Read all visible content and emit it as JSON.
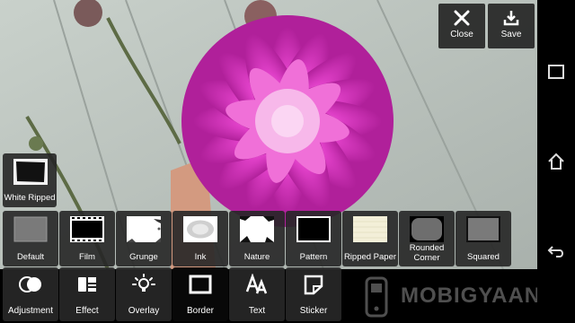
{
  "top_actions": {
    "close_label": "Close",
    "save_label": "Save"
  },
  "selected_border": {
    "label": "White Ripped"
  },
  "border_styles": [
    {
      "label": "Default",
      "icon": "default-border-thumb"
    },
    {
      "label": "Film",
      "icon": "film-border-thumb"
    },
    {
      "label": "Grunge",
      "icon": "grunge-border-thumb"
    },
    {
      "label": "Ink",
      "icon": "ink-border-thumb"
    },
    {
      "label": "Nature",
      "icon": "nature-border-thumb"
    },
    {
      "label": "Pattern",
      "icon": "pattern-border-thumb"
    },
    {
      "label": "Ripped Paper",
      "icon": "ripped-paper-border-thumb"
    },
    {
      "label": "Rounded Corner",
      "icon": "rounded-corner-border-thumb"
    },
    {
      "label": "Squared",
      "icon": "squared-border-thumb"
    }
  ],
  "tools": [
    {
      "label": "Adjustment",
      "icon": "adjustment-icon"
    },
    {
      "label": "Effect",
      "icon": "effect-icon"
    },
    {
      "label": "Overlay",
      "icon": "overlay-icon"
    },
    {
      "label": "Border",
      "icon": "border-icon",
      "selected": true
    },
    {
      "label": "Text",
      "icon": "text-icon"
    },
    {
      "label": "Sticker",
      "icon": "sticker-icon"
    }
  ],
  "watermark": {
    "text": "MOBIGYAAN"
  },
  "nav": {
    "recent_icon": "recent-apps-icon",
    "home_icon": "home-icon",
    "back_icon": "back-icon"
  },
  "colors": {
    "flower": "#e040c8",
    "panel": "#262626",
    "selected_panel": "#0c0c0c"
  }
}
